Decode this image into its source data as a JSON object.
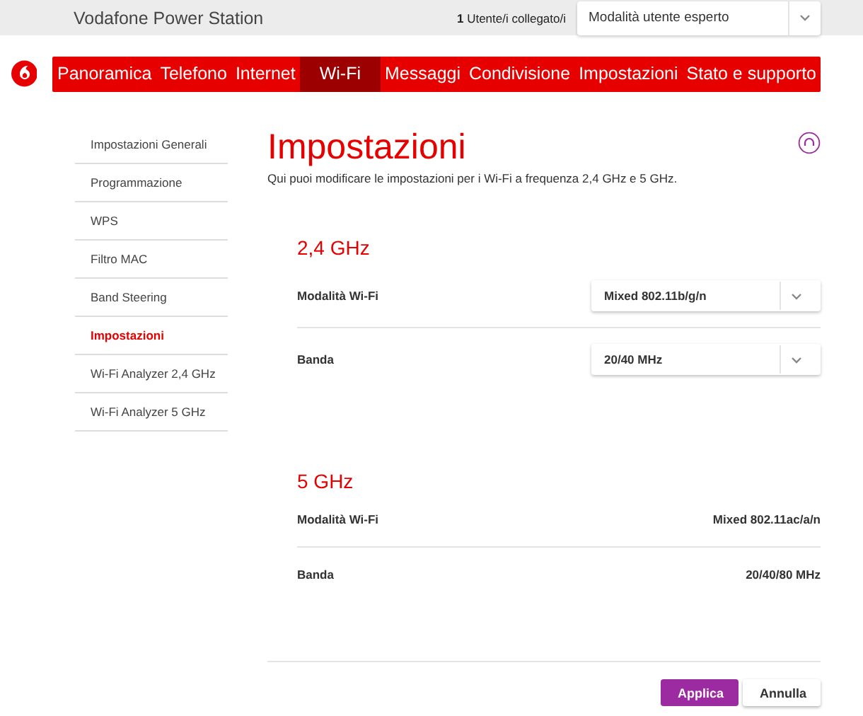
{
  "header": {
    "title": "Vodafone Power Station",
    "users": "**1** Utente/i collegato/i",
    "mode_select": "Modalità utente esperto"
  },
  "nav": [
    {
      "label": "Panoramica",
      "selected": false
    },
    {
      "label": "Telefono",
      "selected": false
    },
    {
      "label": "Internet",
      "selected": false
    },
    {
      "label": "Wi-Fi",
      "selected": true
    },
    {
      "label": "Messaggi",
      "selected": false
    },
    {
      "label": "Condivisione",
      "selected": false
    },
    {
      "label": "Impostazioni",
      "selected": false
    },
    {
      "label": "Stato e supporto",
      "selected": false
    }
  ],
  "sidebar": {
    "items": [
      {
        "label": "Impostazioni Generali",
        "selected": false
      },
      {
        "label": "Programmazione",
        "selected": false
      },
      {
        "label": "WPS",
        "selected": false
      },
      {
        "label": "Filtro MAC",
        "selected": false
      },
      {
        "label": "Band Steering",
        "selected": false
      },
      {
        "label": "Impostazioni",
        "selected": true
      },
      {
        "label": "Wi-Fi Analyzer 2,4 GHz",
        "selected": false
      },
      {
        "label": "Wi-Fi Analyzer 5 GHz",
        "selected": false
      }
    ]
  },
  "page": {
    "title": "Impostazioni",
    "description": "Qui puoi modificare le impostazioni per i Wi-Fi a frequenza 2,4 GHz e 5 GHz.",
    "sections": [
      {
        "title": "2,4 GHz",
        "rows": [
          {
            "kind": "select",
            "label": "Modalità Wi-Fi",
            "value": "Mixed 802.11b/g/n"
          },
          {
            "kind": "select",
            "label": "Banda",
            "value": "20/40 MHz"
          }
        ]
      },
      {
        "title": "5 GHz",
        "rows": [
          {
            "kind": "text",
            "label": "Modalità Wi-Fi",
            "value": "Mixed 802.11ac/a/n"
          },
          {
            "kind": "text",
            "label": "Banda",
            "value": "20/40/80 MHz"
          }
        ]
      }
    ],
    "buttons": [
      {
        "kind": "primary",
        "label": "Applica"
      },
      {
        "kind": "secondary",
        "label": "Annulla"
      }
    ]
  }
}
